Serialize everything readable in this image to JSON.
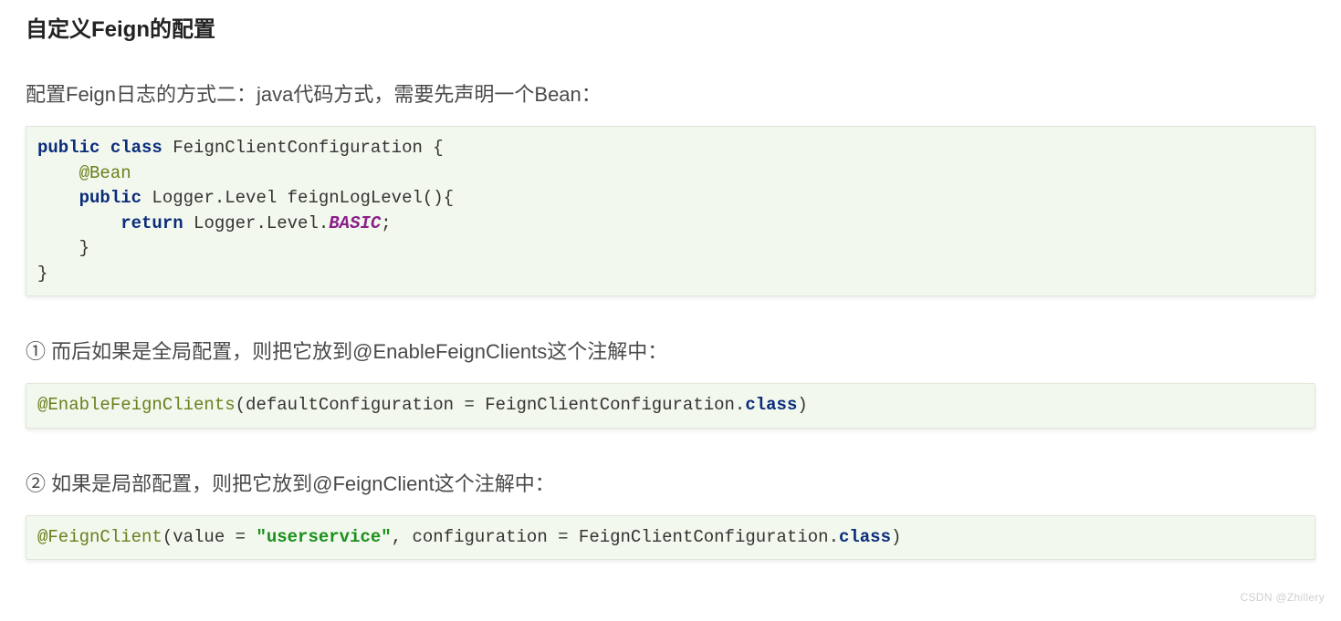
{
  "heading": "自定义Feign的配置",
  "intro": "配置Feign日志的方式二：java代码方式，需要先声明一个Bean：",
  "code1": {
    "l1_kw1": "public",
    "l1_kw2": "class",
    "l1_rest": " FeignClientConfiguration {",
    "l2_ann": "@Bean",
    "l3_kw": "public",
    "l3_rest": " Logger.Level feignLogLevel(){",
    "l4_kw": "return",
    "l4_mid": " Logger.Level.",
    "l4_const": "BASIC",
    "l4_end": ";",
    "l5": "    }",
    "l6": "}"
  },
  "para1_prefix": "①",
  "para1_text": "  而后如果是全局配置，则把它放到@EnableFeignClients这个注解中：",
  "code2": {
    "ann": "@EnableFeignClients",
    "mid": "(defaultConfiguration = FeignClientConfiguration.",
    "cls": "class",
    "end": ")"
  },
  "para2_prefix": "②",
  "para2_text": "  如果是局部配置，则把它放到@FeignClient这个注解中：",
  "code3": {
    "ann": "@FeignClient",
    "open": "(value = ",
    "str": "\"userservice\"",
    "mid": ", configuration = FeignClientConfiguration.",
    "cls": "class",
    "end": ")"
  },
  "watermark": "CSDN @Zhillery"
}
